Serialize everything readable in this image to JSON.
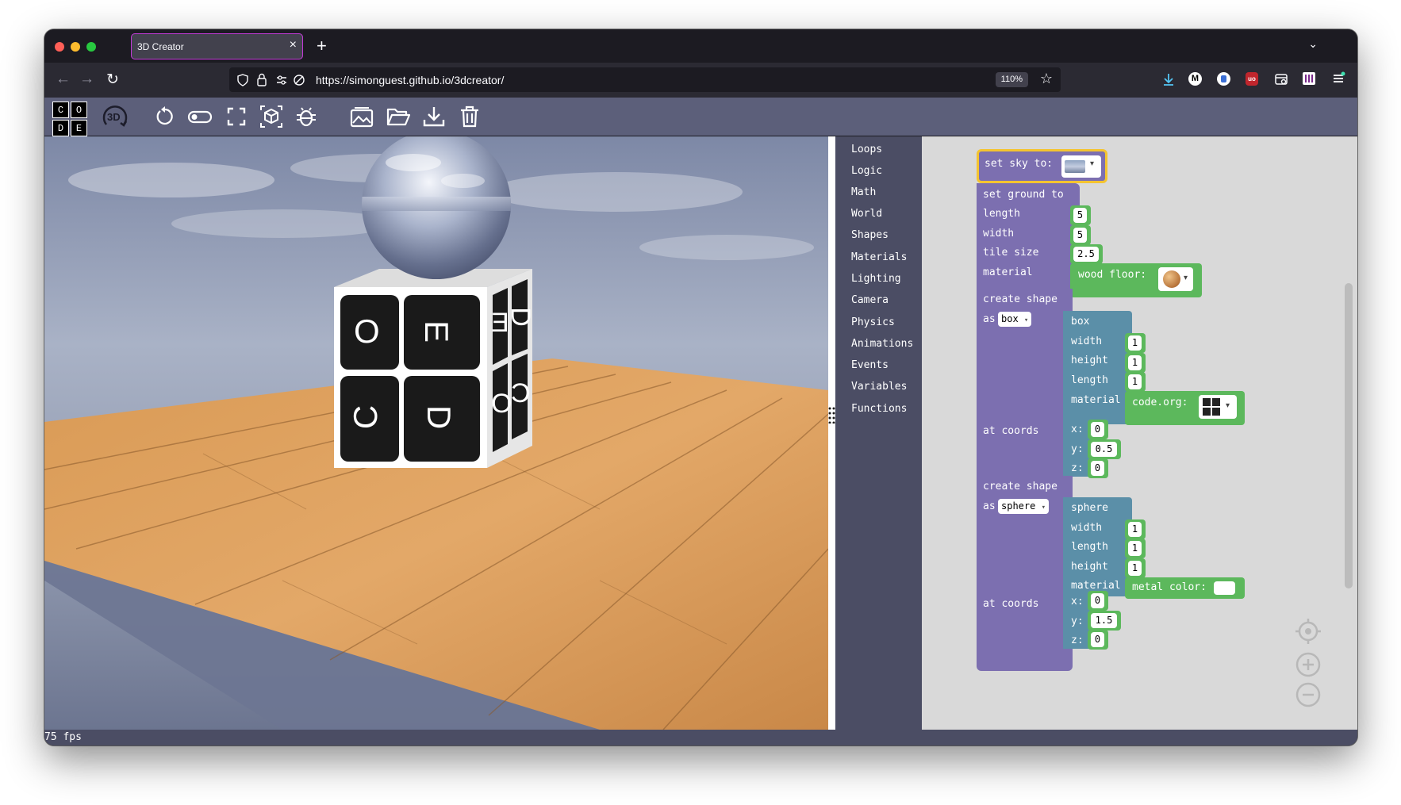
{
  "browser": {
    "tab_title": "3D Creator",
    "tab_close": "×",
    "new_tab": "+",
    "tab_list": "⌄",
    "url": "https://simonguest.github.io/3dcreator/",
    "zoom": "110%"
  },
  "app": {
    "logo_letters": [
      "C",
      "O",
      "D",
      "E"
    ],
    "mode_badge": "3D",
    "toolbar_icons": [
      "reset-icon",
      "toggle-icon",
      "fullscreen-icon",
      "3d-box-icon",
      "debug-icon",
      "gallery-icon",
      "open-folder-icon",
      "download-icon",
      "trash-icon"
    ]
  },
  "categories": [
    "Loops",
    "Logic",
    "Math",
    "World",
    "Shapes",
    "Materials",
    "Lighting",
    "Camera",
    "Physics",
    "Animations",
    "Events",
    "Variables",
    "Functions"
  ],
  "blocks": {
    "sky": {
      "label": "set sky to:"
    },
    "ground": {
      "label": "set ground to",
      "length_label": "length",
      "length": "5",
      "width_label": "width",
      "width": "5",
      "tile_label": "tile size",
      "tile": "2.5",
      "material_label": "material",
      "material_value": "wood floor:"
    },
    "shape1": {
      "label": "create shape",
      "as_label": "as",
      "as_value": "box",
      "name": "box",
      "width_label": "width",
      "width": "1",
      "height_label": "height",
      "height": "1",
      "length_label": "length",
      "length": "1",
      "material_label": "material",
      "material_value": "code.org:",
      "coords_label": "at coords",
      "x_label": "x:",
      "x": "0",
      "y_label": "y:",
      "y": "0.5",
      "z_label": "z:",
      "z": "0"
    },
    "shape2": {
      "label": "create shape",
      "as_label": "as",
      "as_value": "sphere",
      "name": "sphere",
      "width_label": "width",
      "width": "1",
      "length_label": "length",
      "length": "1",
      "height_label": "height",
      "height": "1",
      "material_label": "material",
      "material_value": "metal color:",
      "coords_label": "at coords",
      "x_label": "x:",
      "x": "0",
      "y_label": "y:",
      "y": "1.5",
      "z_label": "z:",
      "z": "0"
    }
  },
  "cube_letters": {
    "front": [
      "O",
      "E",
      "C",
      "D"
    ],
    "side": [
      "D",
      "E",
      "C",
      "O"
    ]
  },
  "status": {
    "fps": "75 fps"
  },
  "colors": {
    "block_purple": "#7c6fb0",
    "block_teal": "#5b8fa8",
    "block_green": "#5cb85c",
    "toolbar": "#5c5f7a",
    "tab_accent": "#c13ad6"
  }
}
